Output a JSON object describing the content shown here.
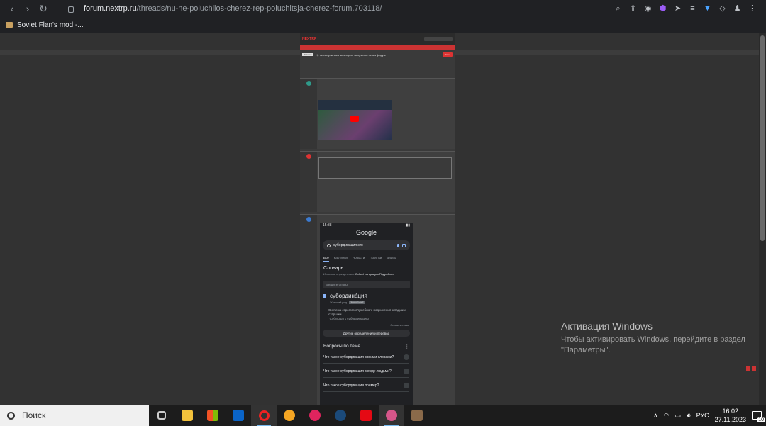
{
  "browser": {
    "url_domain": "forum.nextrp.ru",
    "url_path": "/threads/nu-ne-poluchilos-cherez-rep-poluchitsja-cherez-forum.703118/",
    "bookmark_label": "Soviet Flan's mod -..."
  },
  "forum": {
    "logo": "NEXTRP",
    "thread_tag": "Оказано",
    "thread_title": "Ну не получилось через реп, получится через форум",
    "reply_button": "Ответ"
  },
  "google": {
    "status_time": "15:38",
    "logo": "Google",
    "query": "субординация это",
    "tabs": [
      "Все",
      "Картинки",
      "Новости",
      "Покупки",
      "Видео"
    ],
    "dict_title": "Словарь",
    "dict_source_prefix": "Источник определения:",
    "dict_source": "Oxford Languages",
    "dict_more": "Подробнее",
    "input_placeholder": "Введите слово",
    "word": "субордина́ция",
    "gender": "Женский род",
    "tag": "ЗНАЧЕНИЕ",
    "definition": "Система строгого служебного подчинения младших старшим.",
    "example": "\"Соблюдать субординацию\"",
    "save_label": "Оставить отзыв",
    "more_button": "Другие определения и перевод",
    "questions_title": "Вопросы по теме",
    "questions": [
      "Что такое субординация своими словами?",
      "Что такое субординация между людьми?",
      "Что такое субординация пример?"
    ]
  },
  "activation": {
    "title": "Активация Windows",
    "subtitle": "Чтобы активировать Windows, перейдите в раздел \"Параметры\"."
  },
  "taskbar": {
    "search_label": "Поиск",
    "lang": "РУС",
    "time": "16:02",
    "date": "27.11.2023",
    "notifications": "10"
  }
}
